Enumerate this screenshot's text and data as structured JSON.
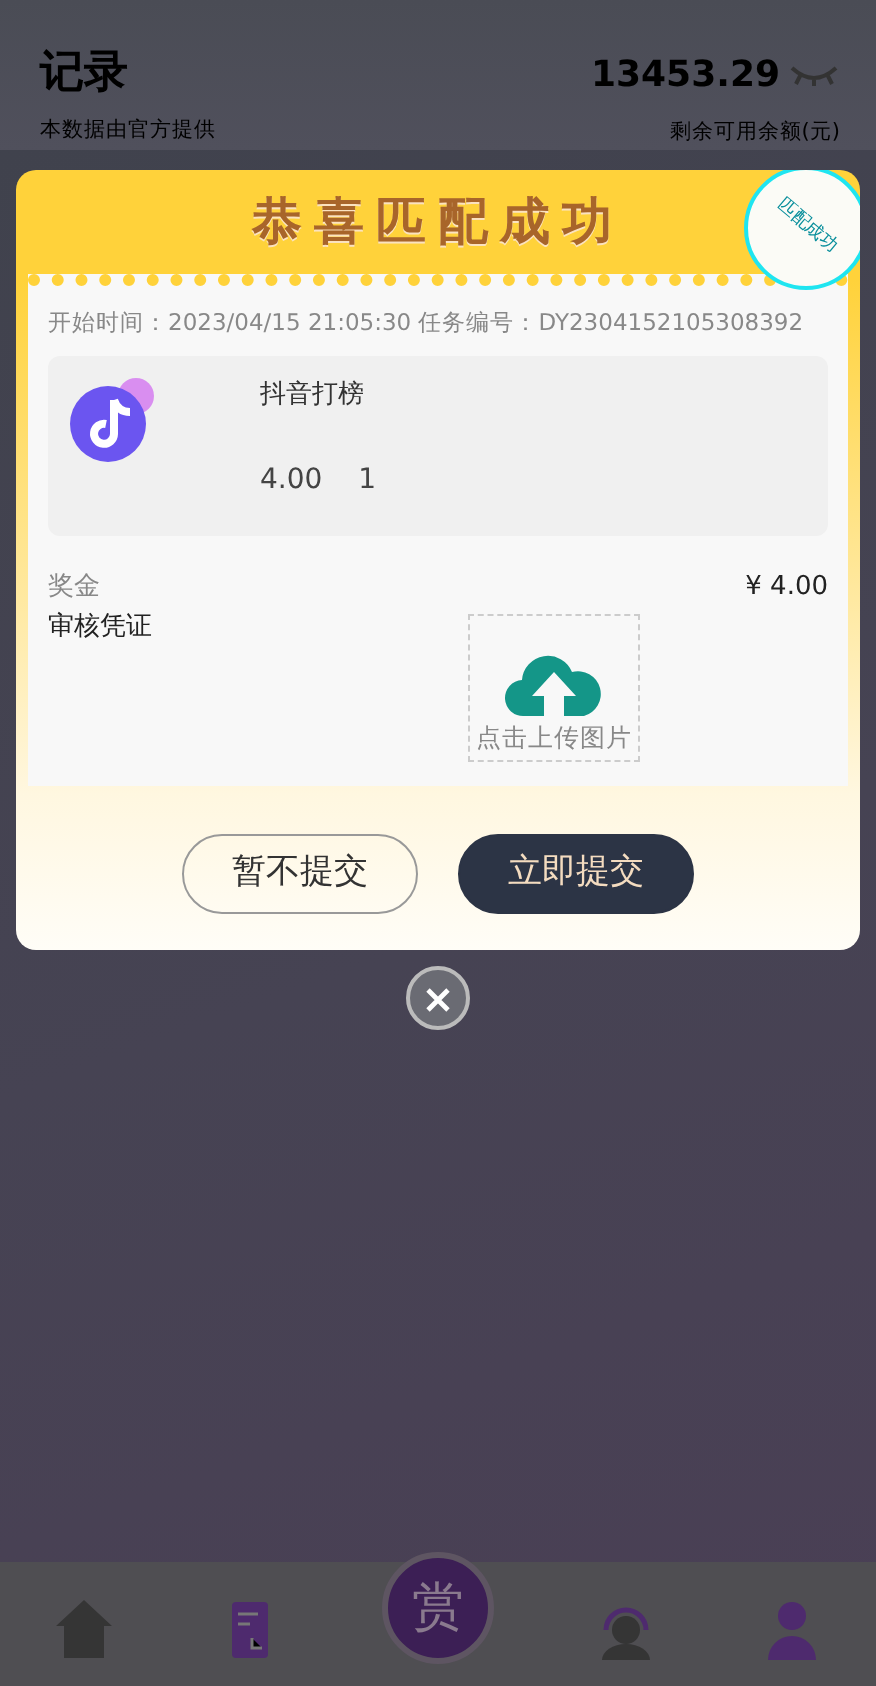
{
  "header": {
    "title": "记录",
    "subtitle": "本数据由官方提供",
    "balance": "13453.29",
    "balance_label": "剩余可用余额(元)"
  },
  "modal": {
    "banner_title": "恭喜匹配成功",
    "start_time": "开始时间：2023/04/15 21:05:30",
    "task_no": "任务编号：DY2304152105308392",
    "stamp": "匹配成功",
    "task": {
      "name": "抖音打榜",
      "price": "4.00",
      "quantity": "1"
    },
    "reward_label": "奖金",
    "reward": "¥ 4.00",
    "proof_label": "审核凭证",
    "upload_label": "点击上传图片",
    "buttons": [
      {
        "label": "暂不提交",
        "kind": "outline"
      },
      {
        "label": "立即提交",
        "kind": "solid"
      }
    ]
  },
  "tab_bar": [
    {
      "kind": "home"
    },
    {
      "kind": "records"
    },
    {
      "kind": "center",
      "label": "赏"
    },
    {
      "kind": "service"
    },
    {
      "kind": "profile"
    }
  ]
}
